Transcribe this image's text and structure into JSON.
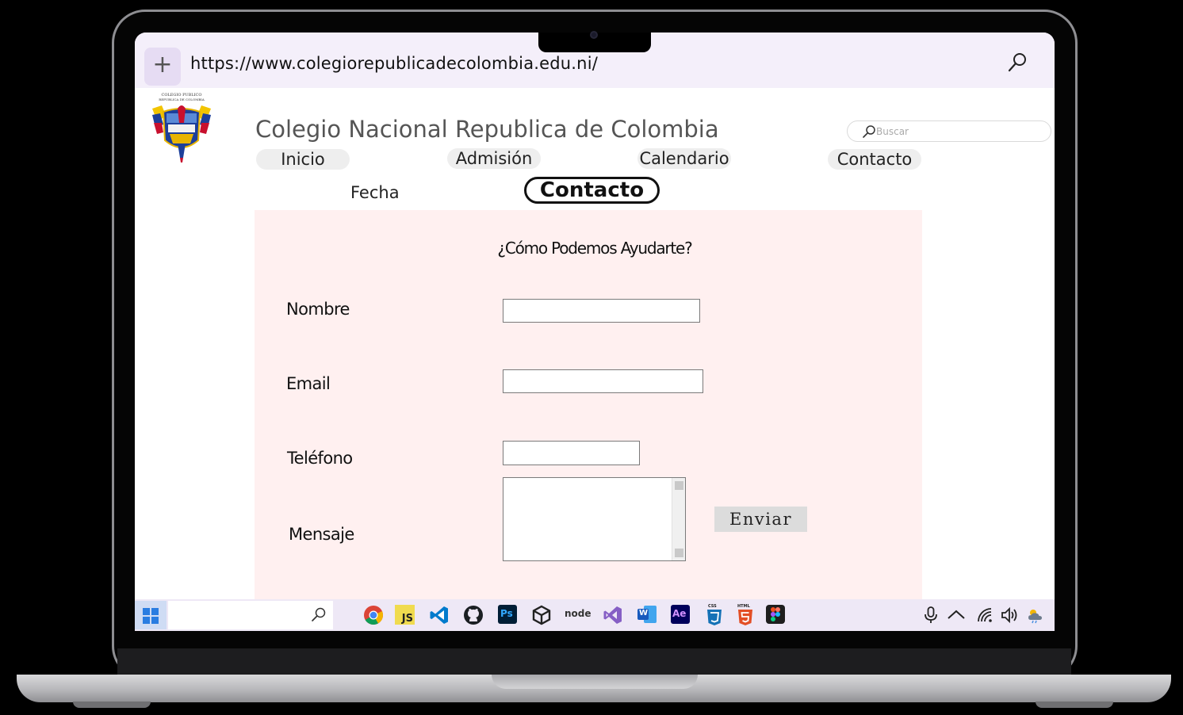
{
  "browser": {
    "url": "https://www.colegiorepublicadecolombia.edu.ni/",
    "new_tab_label": "+"
  },
  "header": {
    "logo_text_line1": "COLEGIO PUBLICO",
    "logo_text_line2": "REPUBLICA DE COLOMBIA",
    "title": "Colegio Nacional Republica de Colombia",
    "search_placeholder": "Buscar"
  },
  "nav": {
    "items": [
      {
        "label": "Inicio"
      },
      {
        "label": "Admisión"
      },
      {
        "label": "Calendario"
      },
      {
        "label": "Contacto"
      }
    ]
  },
  "subnav": {
    "fecha": "Fecha",
    "active": "Contacto"
  },
  "form": {
    "heading": "¿Cómo Podemos Ayudarte?",
    "labels": {
      "name": "Nombre",
      "email": "Email",
      "phone": "Teléfono",
      "message": "Mensaje"
    },
    "values": {
      "name": "",
      "email": "",
      "phone": "",
      "message": ""
    },
    "submit_label": "Enviar"
  },
  "taskbar": {
    "apps": [
      "chrome-icon",
      "javascript-icon",
      "vscode-icon",
      "github-icon",
      "photoshop-icon",
      "unity-icon",
      "nodejs-icon",
      "visual-studio-icon",
      "word-icon",
      "after-effects-icon",
      "css3-icon",
      "html5-icon",
      "figma-icon"
    ],
    "js_label": "JS",
    "ps_label": "Ps",
    "ae_label": "Ae",
    "w_label": "W",
    "node_label": "node",
    "css_label": "CSS",
    "html_label": "HTML",
    "tray": [
      "microphone-icon",
      "chevron-up-icon",
      "wifi-icon",
      "volume-icon",
      "weather-icon"
    ]
  },
  "colors": {
    "browser_bar": "#f4effa",
    "panel_bg": "#fff0f0",
    "taskbar_bg": "#eee8f6",
    "windows_blue": "#2a7de1"
  }
}
